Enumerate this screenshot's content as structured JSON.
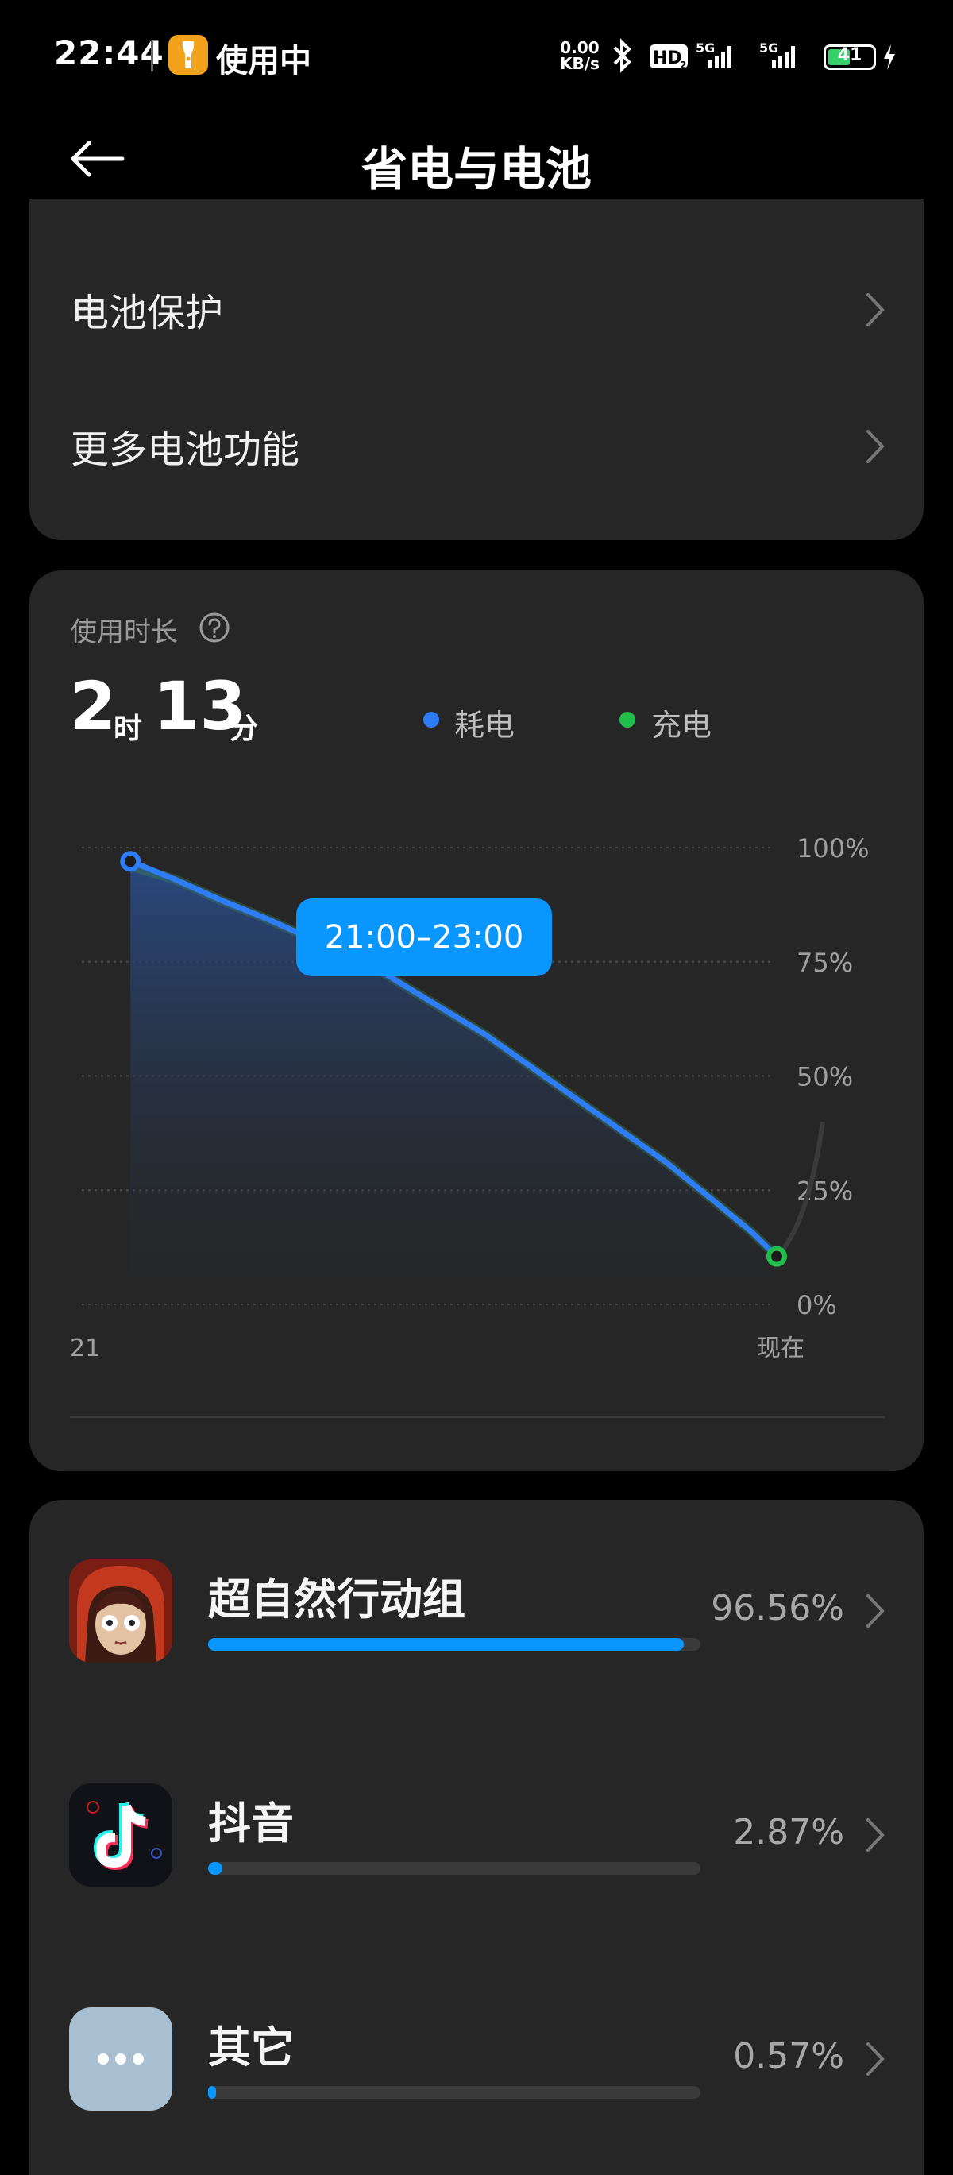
{
  "status_bar": {
    "time": "22:44",
    "app_in_use": "使用中",
    "net_speed_value": "0.00",
    "net_speed_unit": "KB/s",
    "battery_level": "41",
    "icons": [
      "bluetooth-icon",
      "hd-icon",
      "signal-5g-icon",
      "signal-5g-icon",
      "battery-icon",
      "charging-bolt-icon"
    ]
  },
  "header": {
    "title": "省电与电池",
    "back_icon": "arrow-left-icon"
  },
  "menu": {
    "items": [
      {
        "label": "电池保护"
      },
      {
        "label": "更多电池功能"
      }
    ]
  },
  "usage": {
    "title": "使用时长",
    "hours": "2",
    "hours_unit": "时",
    "minutes": "13",
    "minutes_unit": "分",
    "legend": [
      {
        "label": "耗电",
        "color": "#2e7cf6"
      },
      {
        "label": "充电",
        "color": "#1fbf4c"
      }
    ],
    "tooltip": "21:00–23:00",
    "x_labels": [
      "21",
      "现在"
    ],
    "y_labels": [
      "100%",
      "75%",
      "50%",
      "25%",
      "0%"
    ]
  },
  "chart_data": {
    "type": "line",
    "x_labels": [
      "21",
      "现在"
    ],
    "y_ticks": [
      0,
      25,
      50,
      75,
      100
    ],
    "ylim": [
      0,
      100
    ],
    "grid": true,
    "series": [
      {
        "name": "耗电",
        "color": "#2e7cf6",
        "points": [
          [
            0.0,
            97
          ],
          [
            0.07,
            93
          ],
          [
            0.14,
            88.5
          ],
          [
            0.21,
            84.5
          ],
          [
            0.28,
            80
          ],
          [
            0.35,
            76.5
          ],
          [
            0.41,
            71
          ],
          [
            0.48,
            65
          ],
          [
            0.55,
            59
          ],
          [
            0.62,
            52
          ],
          [
            0.69,
            45
          ],
          [
            0.76,
            38
          ],
          [
            0.83,
            31
          ],
          [
            0.9,
            23
          ],
          [
            0.96,
            16
          ],
          [
            1.0,
            10.5
          ]
        ]
      }
    ]
  },
  "apps": [
    {
      "name": "超自然行动组",
      "percent": "96.56%",
      "value": 96.56,
      "icon": "supernatural-squad-app-icon"
    },
    {
      "name": "抖音",
      "percent": "2.87%",
      "value": 2.87,
      "icon": "douyin-app-icon"
    },
    {
      "name": "其它",
      "percent": "0.57%",
      "value": 0.57,
      "icon": "more-dots-icon"
    }
  ]
}
